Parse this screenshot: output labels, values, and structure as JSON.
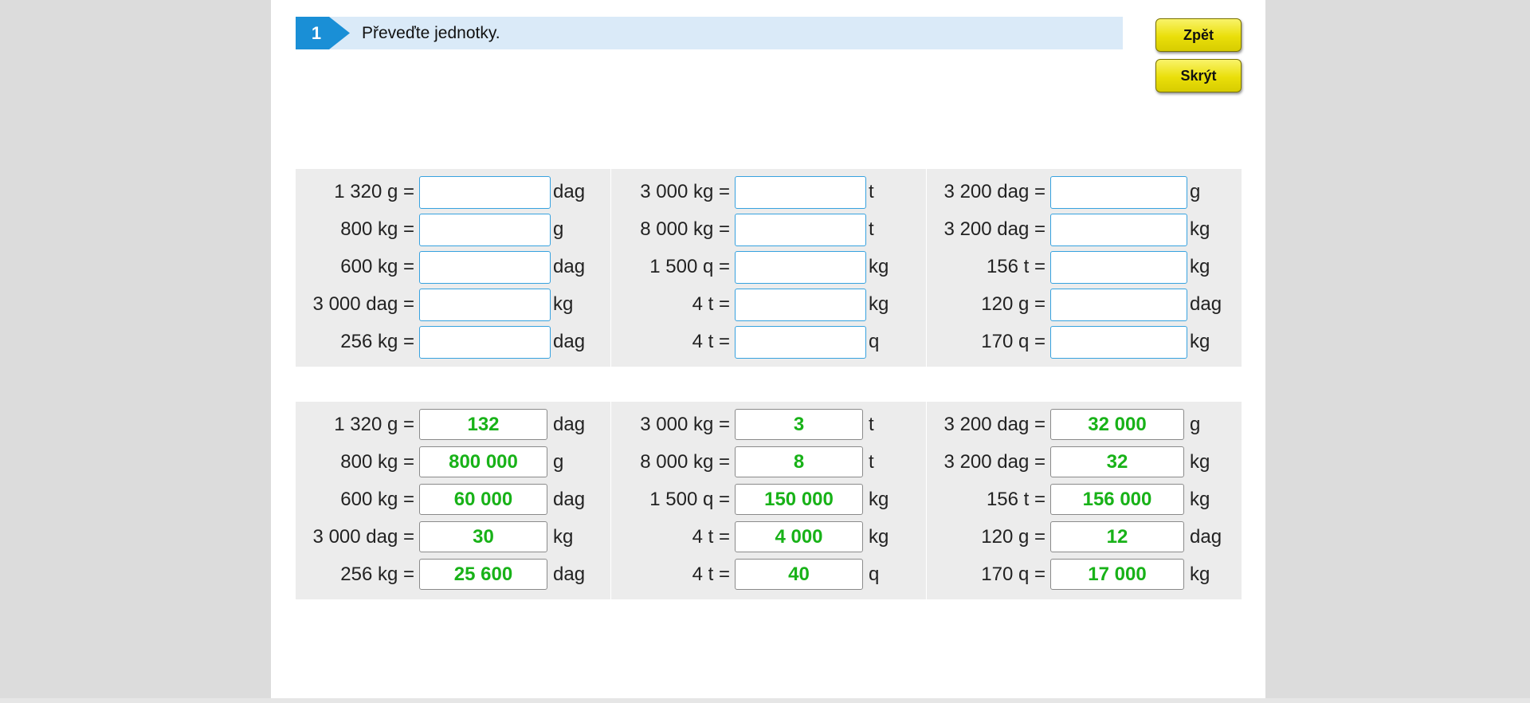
{
  "task": {
    "number": "1",
    "text": "Převeďte jednotky."
  },
  "buttons": {
    "back": "Zpět",
    "hide": "Skrýt"
  },
  "exercise": [
    [
      {
        "expr": "1 320 g =",
        "unit": "dag"
      },
      {
        "expr": "800 kg =",
        "unit": "g"
      },
      {
        "expr": "600 kg =",
        "unit": "dag"
      },
      {
        "expr": "3 000 dag =",
        "unit": "kg"
      },
      {
        "expr": "256 kg =",
        "unit": "dag"
      }
    ],
    [
      {
        "expr": "3 000 kg =",
        "unit": "t"
      },
      {
        "expr": "8 000 kg =",
        "unit": "t"
      },
      {
        "expr": "1 500 q =",
        "unit": "kg"
      },
      {
        "expr": "4 t =",
        "unit": "kg"
      },
      {
        "expr": "4 t =",
        "unit": "q"
      }
    ],
    [
      {
        "expr": "3 200 dag =",
        "unit": "g"
      },
      {
        "expr": "3 200 dag =",
        "unit": "kg"
      },
      {
        "expr": "156 t =",
        "unit": "kg"
      },
      {
        "expr": "120 g =",
        "unit": "dag"
      },
      {
        "expr": "170 q =",
        "unit": "kg"
      }
    ]
  ],
  "solution": [
    [
      {
        "expr": "1 320 g =",
        "value": "132",
        "unit": "dag"
      },
      {
        "expr": "800 kg =",
        "value": "800 000",
        "unit": "g"
      },
      {
        "expr": "600 kg =",
        "value": "60 000",
        "unit": "dag"
      },
      {
        "expr": "3 000 dag =",
        "value": "30",
        "unit": "kg"
      },
      {
        "expr": "256 kg =",
        "value": "25 600",
        "unit": "dag"
      }
    ],
    [
      {
        "expr": "3 000 kg =",
        "value": "3",
        "unit": "t"
      },
      {
        "expr": "8 000 kg =",
        "value": "8",
        "unit": "t"
      },
      {
        "expr": "1 500 q =",
        "value": "150 000",
        "unit": "kg"
      },
      {
        "expr": "4 t =",
        "value": "4 000",
        "unit": "kg"
      },
      {
        "expr": "4 t =",
        "value": "40",
        "unit": "q"
      }
    ],
    [
      {
        "expr": "3 200 dag =",
        "value": "32 000",
        "unit": "g"
      },
      {
        "expr": "3 200 dag =",
        "value": "32",
        "unit": "kg"
      },
      {
        "expr": "156 t =",
        "value": "156 000",
        "unit": "kg"
      },
      {
        "expr": "120 g =",
        "value": "12",
        "unit": "dag"
      },
      {
        "expr": "170 q =",
        "value": "17 000",
        "unit": "kg"
      }
    ]
  ],
  "colors": {
    "accent": "#1a8fd6",
    "header_bg": "#daeaf8",
    "answer": "#18b218",
    "button": "#eadf0a"
  }
}
